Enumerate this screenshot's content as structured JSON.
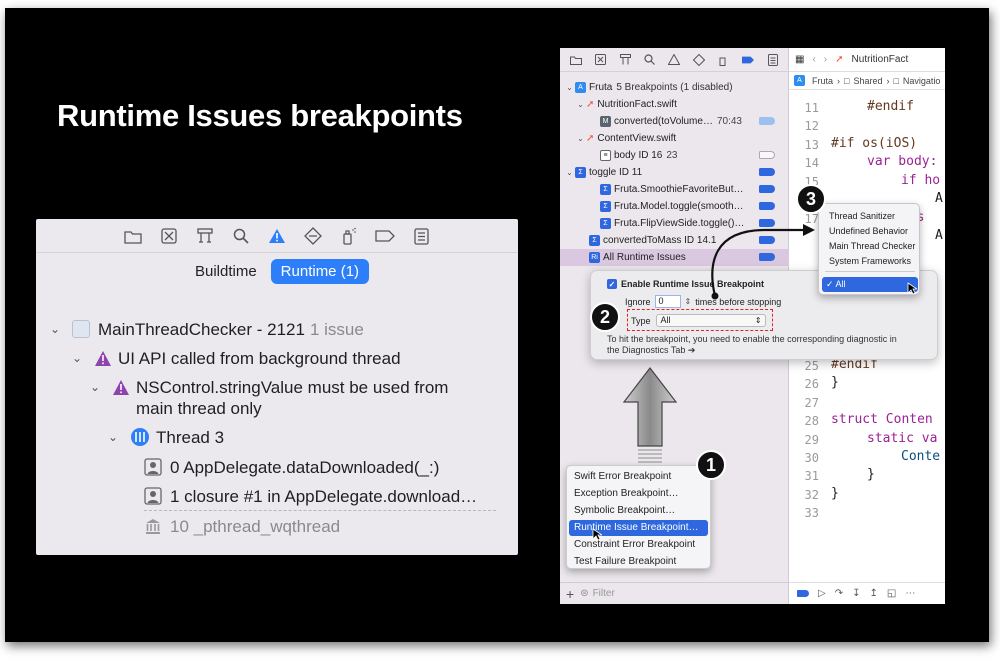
{
  "slide": {
    "title": "Runtime Issues breakpoints"
  },
  "issue_navigator": {
    "tabs": [
      {
        "label": "Buildtime",
        "active": false
      },
      {
        "label": "Runtime (1)",
        "active": true
      }
    ],
    "group": {
      "name": "MainThreadChecker - 2121",
      "count": "1 issue"
    },
    "issue": "UI API called from background thread",
    "detail_line1": "NSControl.stringValue must be used from",
    "detail_line2": "main thread only",
    "thread": "Thread 3",
    "frames": [
      "0 AppDelegate.dataDownloaded(_:)",
      "1 closure #1 in AppDelegate.download…",
      "10 _pthread_wqthread"
    ]
  },
  "breakpoint_navigator": {
    "project": {
      "name": "Fruta",
      "summary": "5 Breakpoints (1 disabled)"
    },
    "rows": [
      {
        "label": "NutritionFact.swift"
      },
      {
        "label": "converted(toVolume…",
        "line": "70:43"
      },
      {
        "label": "ContentView.swift"
      },
      {
        "label": "body ID 16",
        "line": "23"
      },
      {
        "label": "toggle ID 11"
      },
      {
        "label": "Fruta.SmoothieFavoriteBut…"
      },
      {
        "label": "Fruta.Model.toggle(smooth…"
      },
      {
        "label": "Fruta.FlipViewSide.toggle()…"
      },
      {
        "label": "convertedToMass ID 14.1"
      },
      {
        "label": "All Runtime Issues"
      }
    ],
    "filter_placeholder": "Filter"
  },
  "editor": {
    "tab": "NutritionFact",
    "jump_bar": [
      "Fruta",
      "Shared",
      "Navigatio"
    ],
    "line_numbers": [
      "11",
      "12",
      "13",
      "14",
      "15",
      "16",
      "17",
      "25",
      "26",
      "27",
      "28",
      "29",
      "30",
      "31",
      "32",
      "33"
    ],
    "code": [
      "#endif",
      "#if os(iOS)",
      "var body:",
      "if ho",
      "A",
      "els",
      "A",
      "#endif",
      "}",
      "struct Conten",
      "static va",
      "Conte",
      "}",
      "}"
    ]
  },
  "popover": {
    "enable_label": "Enable Runtime Issue Breakpoint",
    "ignore_label": "Ignore",
    "ignore_value": "0",
    "ignore_suffix": "times before stopping",
    "type_label": "Type",
    "type_value": "All",
    "help_text": "To hit the breakpoint, you need to enable the corresponding diagnostic in the Diagnostics Tab ➔"
  },
  "type_menu": {
    "items": [
      "Thread Sanitizer",
      "Undefined Behavior",
      "Main Thread Checker",
      "System Frameworks"
    ],
    "selected": "✓ All"
  },
  "add_menu": {
    "items": [
      "Swift Error Breakpoint",
      "Exception Breakpoint…",
      "Symbolic Breakpoint…",
      "Runtime Issue Breakpoint…",
      "Constraint Error Breakpoint",
      "Test Failure Breakpoint"
    ],
    "highlighted_index": 3
  },
  "badges": [
    "1",
    "2",
    "3"
  ],
  "colors": {
    "accent": "#2f67de",
    "warning": "#8e44ad",
    "annotation": "#e0222c"
  }
}
